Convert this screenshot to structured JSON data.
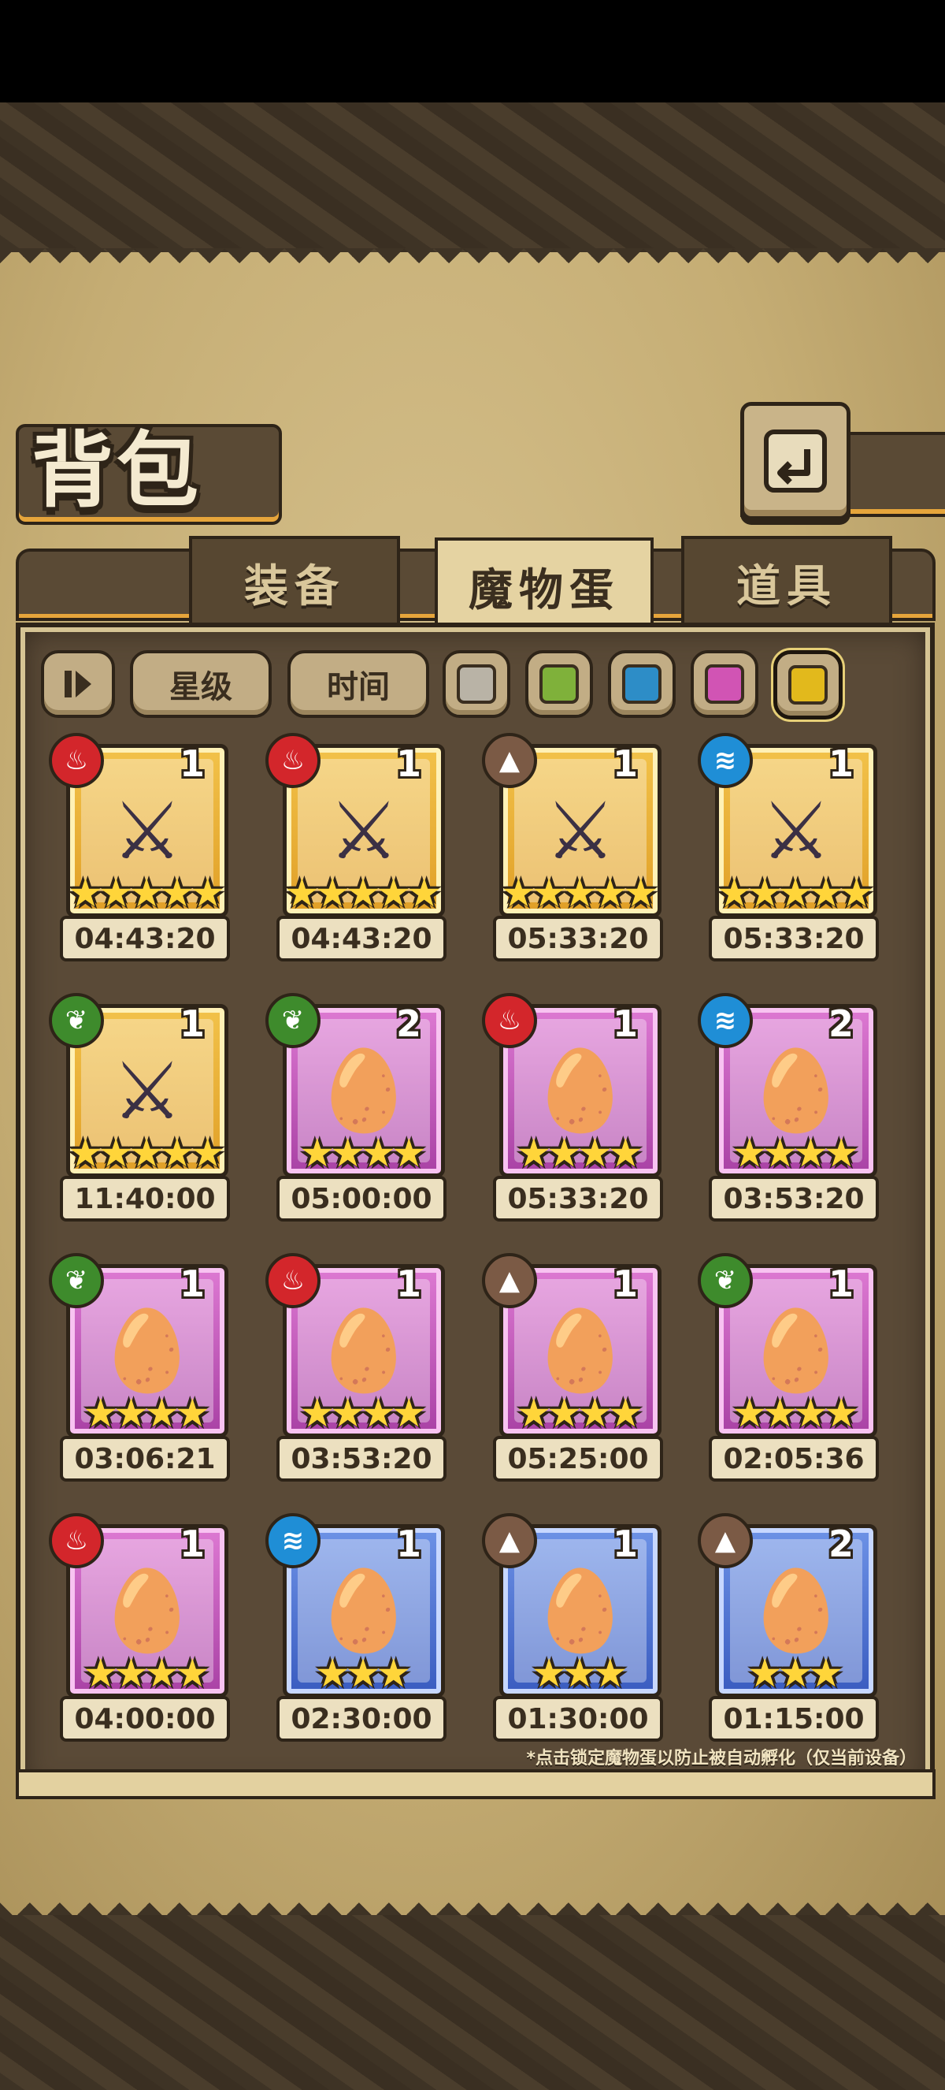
{
  "title": "背包",
  "tabs": [
    {
      "label": "装备",
      "active": false
    },
    {
      "label": "魔物蛋",
      "active": true
    },
    {
      "label": "道具",
      "active": false
    }
  ],
  "filters": {
    "sort_icon": "sort-toggle-icon",
    "star_label": "星级",
    "time_label": "时间",
    "colors": [
      "#b9b3a6",
      "#7fb13a",
      "#2d8dc7",
      "#d154b4",
      "#e2b91c"
    ],
    "selected_color_index": 4
  },
  "eggs": [
    {
      "element": "fire",
      "rarity": "gold",
      "count": "1",
      "stars": 5,
      "timer": "04:43:20",
      "icon": "witch-hat-item"
    },
    {
      "element": "fire",
      "rarity": "gold",
      "count": "1",
      "stars": 5,
      "timer": "04:43:20",
      "icon": "crossbow-item"
    },
    {
      "element": "earth",
      "rarity": "gold",
      "count": "1",
      "stars": 5,
      "timer": "05:33:20",
      "icon": "hammer-item"
    },
    {
      "element": "water",
      "rarity": "gold",
      "count": "1",
      "stars": 5,
      "timer": "05:33:20",
      "icon": "sword-item"
    },
    {
      "element": "nature",
      "rarity": "gold",
      "count": "1",
      "stars": 5,
      "timer": "11:40:00",
      "icon": "winged-egg"
    },
    {
      "element": "nature",
      "rarity": "purple",
      "count": "2",
      "stars": 4,
      "timer": "05:00:00",
      "icon": "dark-mage"
    },
    {
      "element": "fire",
      "rarity": "purple",
      "count": "1",
      "stars": 4,
      "timer": "05:33:20",
      "icon": "dagger-item"
    },
    {
      "element": "water",
      "rarity": "purple",
      "count": "2",
      "stars": 4,
      "timer": "03:53:20",
      "icon": "pudding-item"
    },
    {
      "element": "nature",
      "rarity": "purple",
      "count": "1",
      "stars": 4,
      "timer": "03:06:21",
      "icon": "leaf-egg"
    },
    {
      "element": "fire",
      "rarity": "purple",
      "count": "1",
      "stars": 4,
      "timer": "03:53:20",
      "icon": "bat-egg"
    },
    {
      "element": "earth",
      "rarity": "purple",
      "count": "1",
      "stars": 4,
      "timer": "05:25:00",
      "icon": "fur-egg"
    },
    {
      "element": "nature",
      "rarity": "purple",
      "count": "1",
      "stars": 4,
      "timer": "02:05:36",
      "icon": "spike-egg"
    },
    {
      "element": "fire",
      "rarity": "purple",
      "count": "1",
      "stars": 4,
      "timer": "04:00:00",
      "icon": "slime-egg"
    },
    {
      "element": "water",
      "rarity": "blue",
      "count": "1",
      "stars": 3,
      "timer": "02:30:00",
      "icon": "mask-egg"
    },
    {
      "element": "earth",
      "rarity": "blue",
      "count": "1",
      "stars": 3,
      "timer": "01:30:00",
      "icon": "jelly-egg"
    },
    {
      "element": "earth",
      "rarity": "blue",
      "count": "2",
      "stars": 3,
      "timer": "01:15:00",
      "icon": "chocolate-egg"
    }
  ],
  "footnote": "*点击锁定魔物蛋以防止被自动孵化（仅当前设备）"
}
